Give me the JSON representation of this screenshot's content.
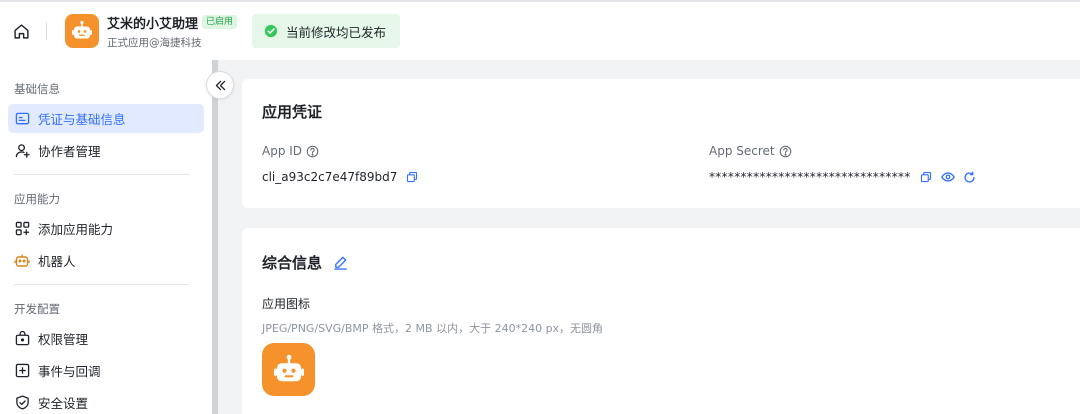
{
  "header": {
    "app_name": "艾米的小艾助理",
    "status_badge": "已启用",
    "app_subtitle": "正式应用@海捷科技",
    "publish_status": "当前修改均已发布"
  },
  "sidebar": {
    "groups": [
      {
        "title": "基础信息",
        "items": [
          {
            "label": "凭证与基础信息",
            "icon": "id-card-icon",
            "active": true
          },
          {
            "label": "协作者管理",
            "icon": "user-add-icon"
          }
        ]
      },
      {
        "title": "应用能力",
        "items": [
          {
            "label": "添加应用能力",
            "icon": "apps-grid-icon"
          },
          {
            "label": "机器人",
            "icon": "robot-icon"
          }
        ]
      },
      {
        "title": "开发配置",
        "items": [
          {
            "label": "权限管理",
            "icon": "lock-box-icon"
          },
          {
            "label": "事件与回调",
            "icon": "plus-square-icon"
          },
          {
            "label": "安全设置",
            "icon": "shield-icon"
          }
        ]
      }
    ]
  },
  "credentials": {
    "title": "应用凭证",
    "app_id_label": "App ID",
    "app_id_value": "cli_a93c2c7e47f89bd7",
    "app_secret_label": "App Secret",
    "app_secret_value": "********************************"
  },
  "general": {
    "title": "综合信息",
    "icon_label": "应用图标",
    "icon_hint": "JPEG/PNG/SVG/BMP 格式，2 MB 以内，大于 240*240 px，无圆角"
  },
  "colors": {
    "brand_orange": "#f5922b",
    "accent_blue": "#3370ff",
    "success_green": "#25a244"
  }
}
